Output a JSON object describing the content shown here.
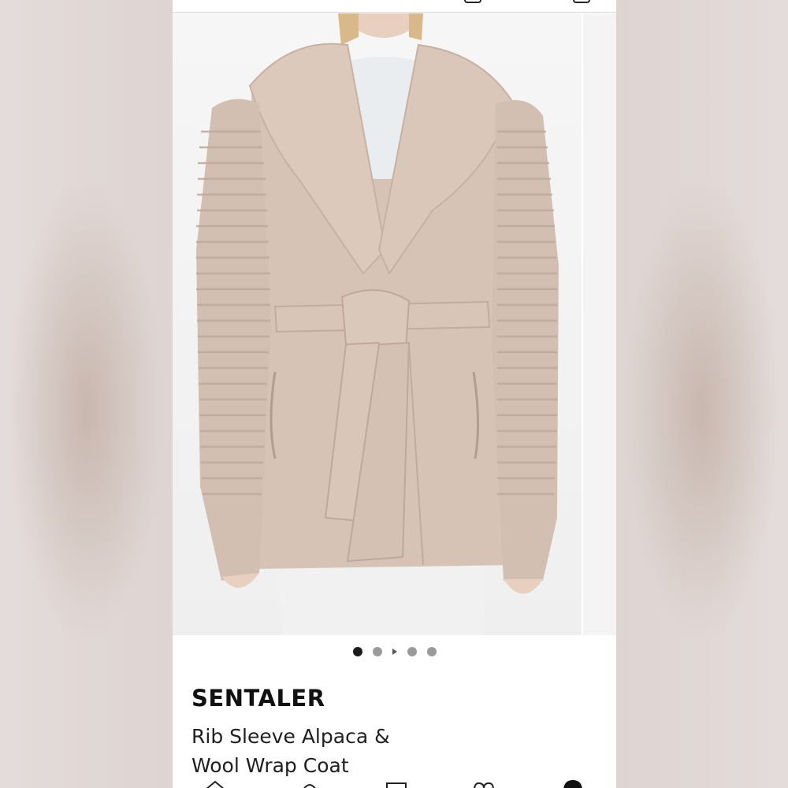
{
  "product": {
    "brand": "SENTALER",
    "title_line1": "Rib Sleeve Alpaca &",
    "title_line2": "Wool Wrap Coat"
  },
  "carousel": {
    "dots": [
      {
        "active": true
      },
      {
        "active": false
      },
      {
        "type": "video"
      },
      {
        "active": false
      },
      {
        "active": false
      }
    ]
  },
  "icons": {
    "top_bar": [
      "share-icon",
      "bag-icon"
    ],
    "bottom_nav": [
      "home-icon",
      "search-icon",
      "list-icon",
      "heart-icon",
      "account-icon"
    ]
  },
  "colors": {
    "coat": "#d6c3b6",
    "background": "#ffffff",
    "active_dot": "#1a1a1a",
    "inactive_dot": "#9a9a9a"
  }
}
